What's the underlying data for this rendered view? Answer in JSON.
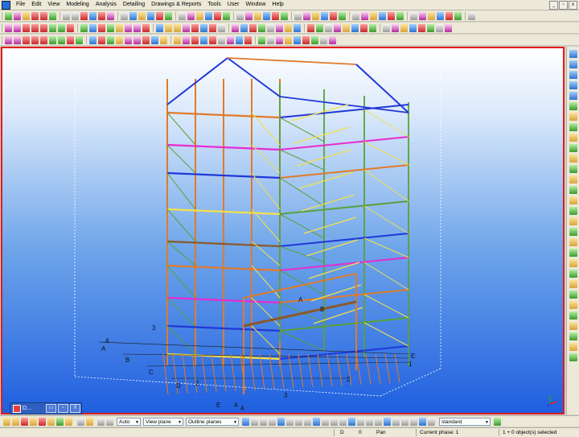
{
  "menubar": {
    "items": [
      "File",
      "Edit",
      "View",
      "Modeling",
      "Analysis",
      "Detailing",
      "Drawings & Reports",
      "Tools",
      "User",
      "Window",
      "Help"
    ],
    "window_controls": [
      "_",
      "▫",
      "x"
    ]
  },
  "toolbar": {
    "row1_icons": [
      "new",
      "open",
      "save",
      "print",
      "undo",
      "redo",
      "zoom",
      "pan",
      "select",
      "copy",
      "move",
      "delete",
      "properties",
      "magnet",
      "snap",
      "snap",
      "snap",
      "snap",
      "snap",
      "snap",
      "snap",
      "snap",
      "snap",
      "snap",
      "snap",
      "snap",
      "snap",
      "snap",
      "snap",
      "snap",
      "snap",
      "snap",
      "snap",
      "snap",
      "snap",
      "snap",
      "snap",
      "snap",
      "snap",
      "snap",
      "snap",
      "snap",
      "snap",
      "snap",
      "snap",
      "snap",
      "snap",
      "snap",
      "snap"
    ],
    "row2_icons": [
      "steel",
      "beam",
      "column",
      "plate",
      "bolt",
      "weld",
      "cut",
      "fitting",
      "chamfer",
      "grid",
      "view",
      "clip",
      "render",
      "part",
      "component",
      "macro",
      "numbering",
      "drawing",
      "report",
      "lock",
      "unlock",
      "hide",
      "show",
      "color",
      "class",
      "filter",
      "select",
      "select",
      "select",
      "select",
      "select",
      "select",
      "select",
      "select",
      "select",
      "select",
      "select",
      "select",
      "select",
      "select",
      "select",
      "select",
      "select",
      "select",
      "select",
      "select",
      "select",
      "select"
    ]
  },
  "viewport": {
    "grid_labels": [
      "A",
      "B",
      "C",
      "D",
      "E",
      "A",
      "B",
      "E",
      "3",
      "4",
      "4",
      "3",
      "2",
      "1",
      "2",
      "4"
    ]
  },
  "right_toolbar": {
    "icons": [
      "arrow-up",
      "refresh",
      "move-left",
      "move-right",
      "select",
      "component-1",
      "component-2",
      "component-3",
      "component-4",
      "component-5",
      "component-6",
      "component-7",
      "component-8",
      "component-9",
      "component-10",
      "component-11",
      "component-12",
      "component-13",
      "component-14",
      "component-15",
      "component-16",
      "component-17",
      "component-18",
      "component-19",
      "component-20",
      "component-21",
      "component-22",
      "component-23",
      "component-24",
      "component-25"
    ]
  },
  "taskbar_mini": {
    "label": "D...",
    "buttons": [
      "▭",
      "▫",
      "X"
    ]
  },
  "bottom_toolbar": {
    "combo_auto": "Auto",
    "combo_view_plane": "View plane",
    "combo_outline": "Outline planes",
    "combo_standard": "standard"
  },
  "statusbar": {
    "d": "D",
    "zero": "0",
    "pan": "Pan",
    "phase": "Current phase: 1",
    "selection": "1 + 0 object(s) selected"
  },
  "colors": {
    "viewport_border": "#e41b1b",
    "sky_top": "#ffffff",
    "sky_bottom": "#1f5fe0",
    "beam_orange": "#e07b2a",
    "beam_magenta": "#e82bd0",
    "beam_blue": "#2038d8",
    "beam_green": "#5aa13a",
    "beam_yellow": "#f4e04a",
    "beam_brown": "#8a5a2a"
  }
}
